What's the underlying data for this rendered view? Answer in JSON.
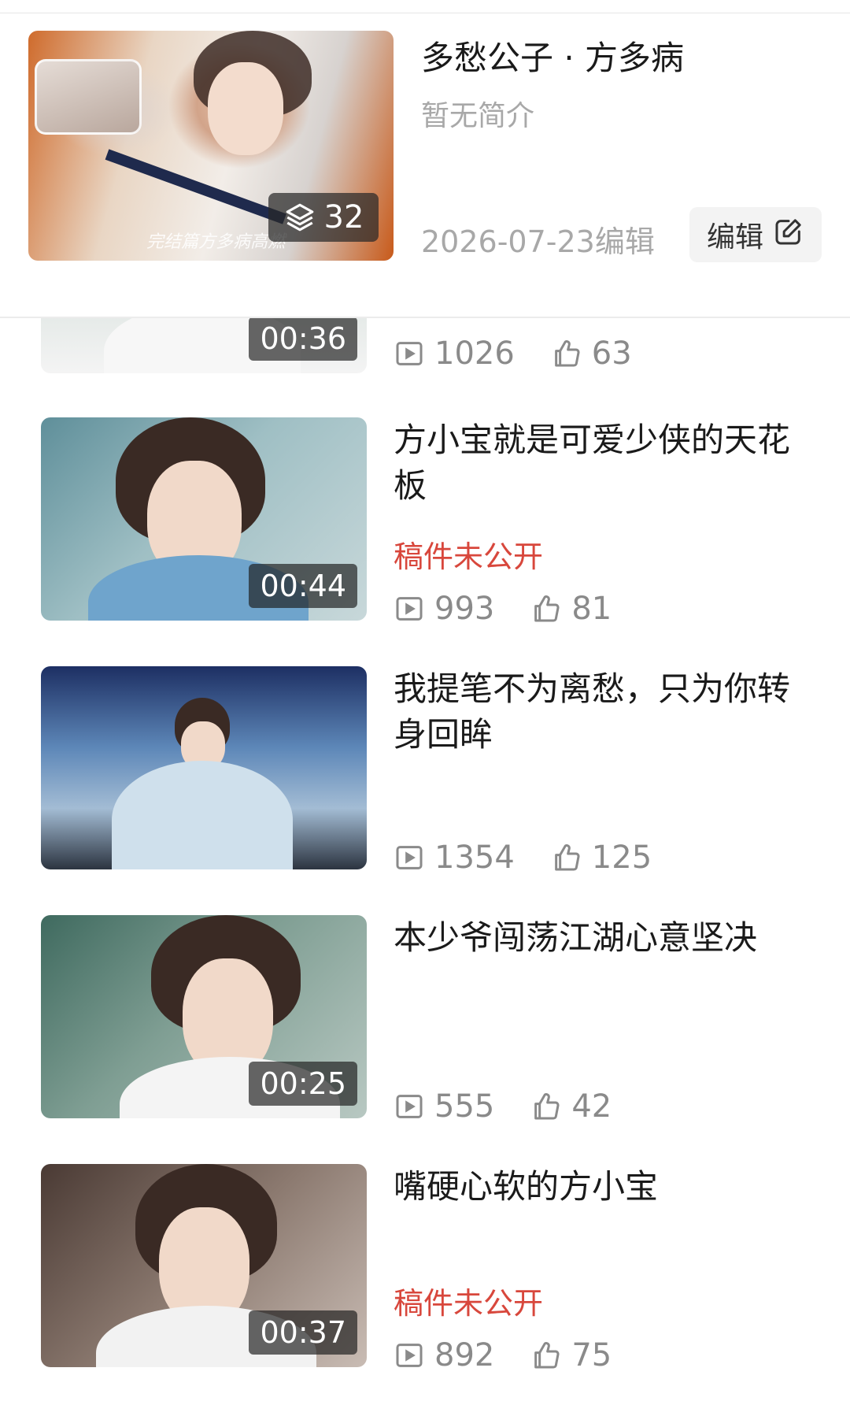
{
  "collection": {
    "title": "多愁公子 · 方多病",
    "description": "暂无简介",
    "edited_date": "2026-07-23编辑",
    "edit_label": "编辑",
    "video_count": "32",
    "cover_caption": "完结篇方多病高燃"
  },
  "videos": [
    {
      "duration": "00:36",
      "views": "1026",
      "likes": "63"
    },
    {
      "title": "方小宝就是可爱少侠的天花板",
      "status": "稿件未公开",
      "duration": "00:44",
      "views": "993",
      "likes": "81"
    },
    {
      "title": "我提笔不为离愁，只为你转身回眸",
      "status": "",
      "duration": "",
      "views": "1354",
      "likes": "125"
    },
    {
      "title": "本少爷闯荡江湖心意坚决",
      "status": "",
      "duration": "00:25",
      "views": "555",
      "likes": "42"
    },
    {
      "title": "嘴硬心软的方小宝",
      "status": "稿件未公开",
      "duration": "00:37",
      "views": "892",
      "likes": "75"
    }
  ],
  "icons": {
    "layers": "layers-icon",
    "edit": "edit-icon",
    "play": "play-count-icon",
    "like": "thumbs-up-icon"
  },
  "colors": {
    "private_status": "#d8473c",
    "secondary_text": "#8a8a8a"
  }
}
